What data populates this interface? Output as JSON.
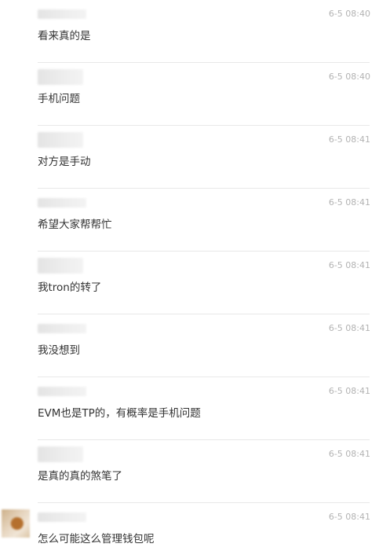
{
  "comments": [
    {
      "time": "6-5 08:40",
      "text": "看来真的是"
    },
    {
      "time": "6-5 08:40",
      "text": "手机问题"
    },
    {
      "time": "6-5 08:41",
      "text": "对方是手动"
    },
    {
      "time": "6-5 08:41",
      "text": "希望大家帮帮忙"
    },
    {
      "time": "6-5 08:41",
      "text": "我tron的转了"
    },
    {
      "time": "6-5 08:41",
      "text": "我没想到"
    },
    {
      "time": "6-5 08:41",
      "text": "EVM也是TP的，有概率是手机问题"
    },
    {
      "time": "6-5 08:41",
      "text": "是真的真的煞笔了"
    },
    {
      "time": "6-5 08:41",
      "text": "怎么可能这么管理钱包呢"
    }
  ]
}
